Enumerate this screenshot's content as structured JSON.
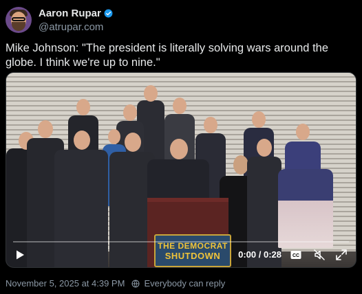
{
  "author": {
    "display_name": "Aaron Rupar",
    "handle": "@atrupar.com",
    "verified": true,
    "verified_color": "#1d9bf0"
  },
  "tweet": {
    "text": "Mike Johnson: \"The president is literally solving wars around the globe. I think we're up to nine.\""
  },
  "video": {
    "sign_line1": "THE DEMOCRAT",
    "sign_line2": "SHUTDOWN",
    "time": "0:00 / 0:28",
    "cc_label": "CC",
    "progress": 0
  },
  "footer": {
    "timestamp": "November 5, 2025 at 4:39 PM",
    "reply_setting": "Everybody can reply"
  },
  "colors": {
    "background": "#000000",
    "text": "#e7e9ea",
    "muted": "#8b98a5"
  }
}
